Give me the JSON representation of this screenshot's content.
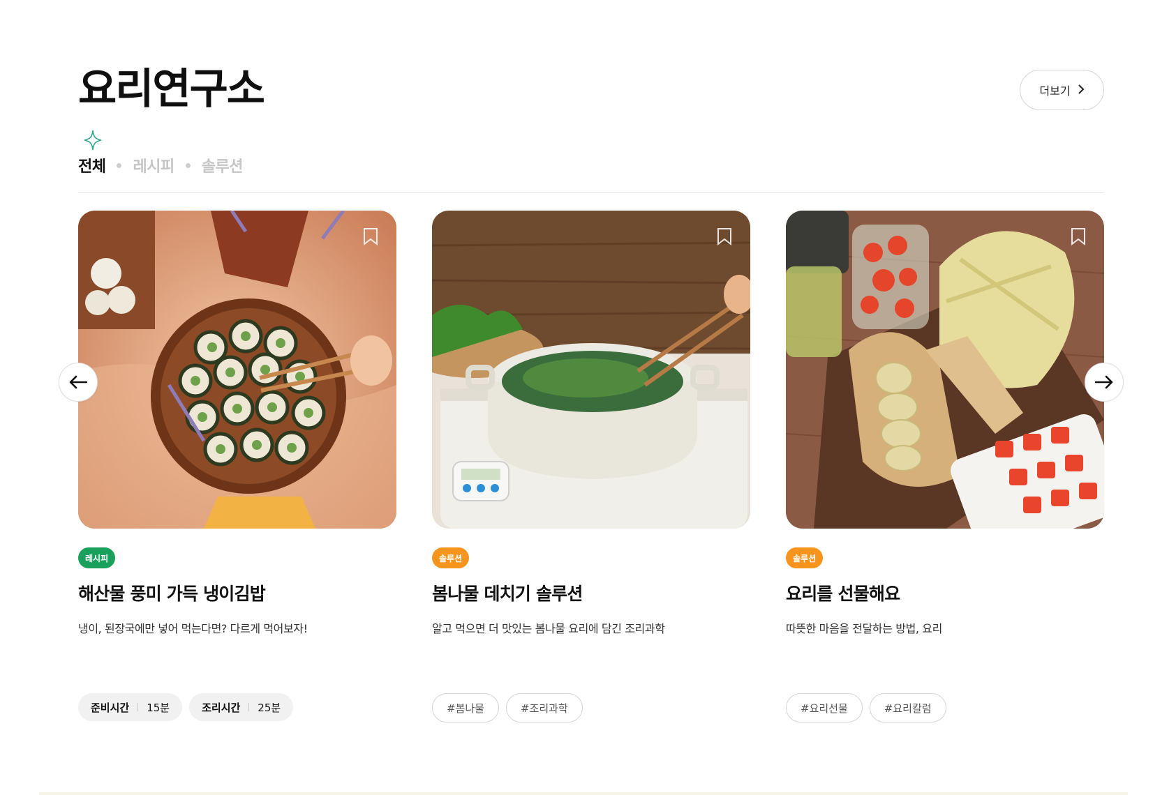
{
  "section": {
    "title": "요리연구소",
    "more_label": "더보기",
    "more_chevron": "›"
  },
  "tabs": [
    {
      "label": "전체",
      "active": true
    },
    {
      "label": "레시피",
      "active": false
    },
    {
      "label": "솔루션",
      "active": false
    }
  ],
  "icons": {
    "sparkle": "sparkle-icon",
    "bookmark": "bookmark-icon",
    "arrow_left": "arrow-left-icon",
    "arrow_right": "arrow-right-icon"
  },
  "colors": {
    "badge_recipe": "#18a05c",
    "badge_solution": "#f7941d",
    "sparkle": "#2fa58a"
  },
  "cards": [
    {
      "badge": "레시피",
      "title": "해산물 풍미 가득 냉이김밥",
      "description": "냉이, 된장국에만 넣어 먹는다면? 다르게 먹어보자!",
      "meta": [
        {
          "label": "준비시간",
          "value": "15분"
        },
        {
          "label": "조리시간",
          "value": "25분"
        }
      ]
    },
    {
      "badge": "솔루션",
      "title": "봄나물 데치기 솔루션",
      "description": "알고 먹으면 더 맛있는 봄나물 요리에 담긴 조리과학",
      "tags": [
        "#봄나물",
        "#조리과학"
      ]
    },
    {
      "badge": "솔루션",
      "title": "요리를 선물해요",
      "description": "따뜻한 마음을 전달하는 방법, 요리",
      "tags": [
        "#요리선물",
        "#요리칼럼"
      ]
    }
  ]
}
